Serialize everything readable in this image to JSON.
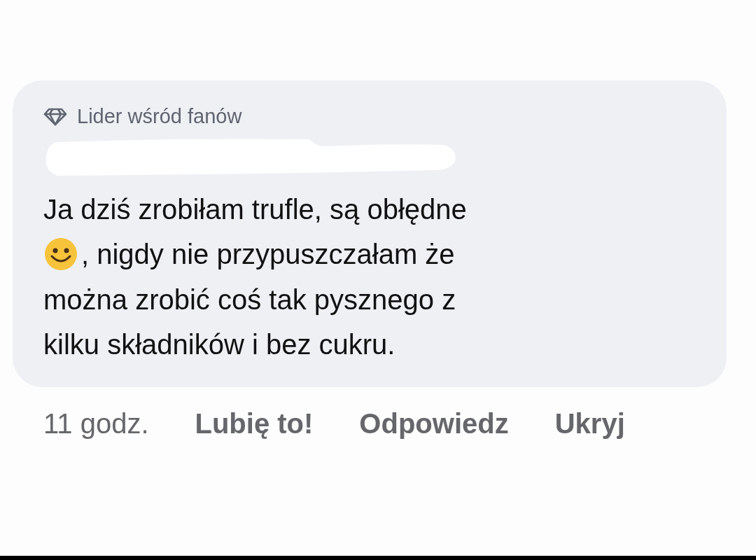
{
  "comment": {
    "badge": "Lider wśród fanów",
    "lines": [
      [
        {
          "kind": "text",
          "text": "Ja dziś zrobiłam trufle, są obłędne"
        }
      ],
      [
        {
          "kind": "emoji"
        },
        {
          "kind": "text",
          "text": ", nigdy nie przypuszczałam że"
        }
      ],
      [
        {
          "kind": "text",
          "text": "można zrobić coś tak pysznego z"
        }
      ],
      [
        {
          "kind": "text",
          "text": "kilku składników i bez cukru."
        }
      ]
    ]
  },
  "time": "11 godz.",
  "actions": [
    "Lubię to!",
    "Odpowiedz",
    "Ukryj"
  ]
}
